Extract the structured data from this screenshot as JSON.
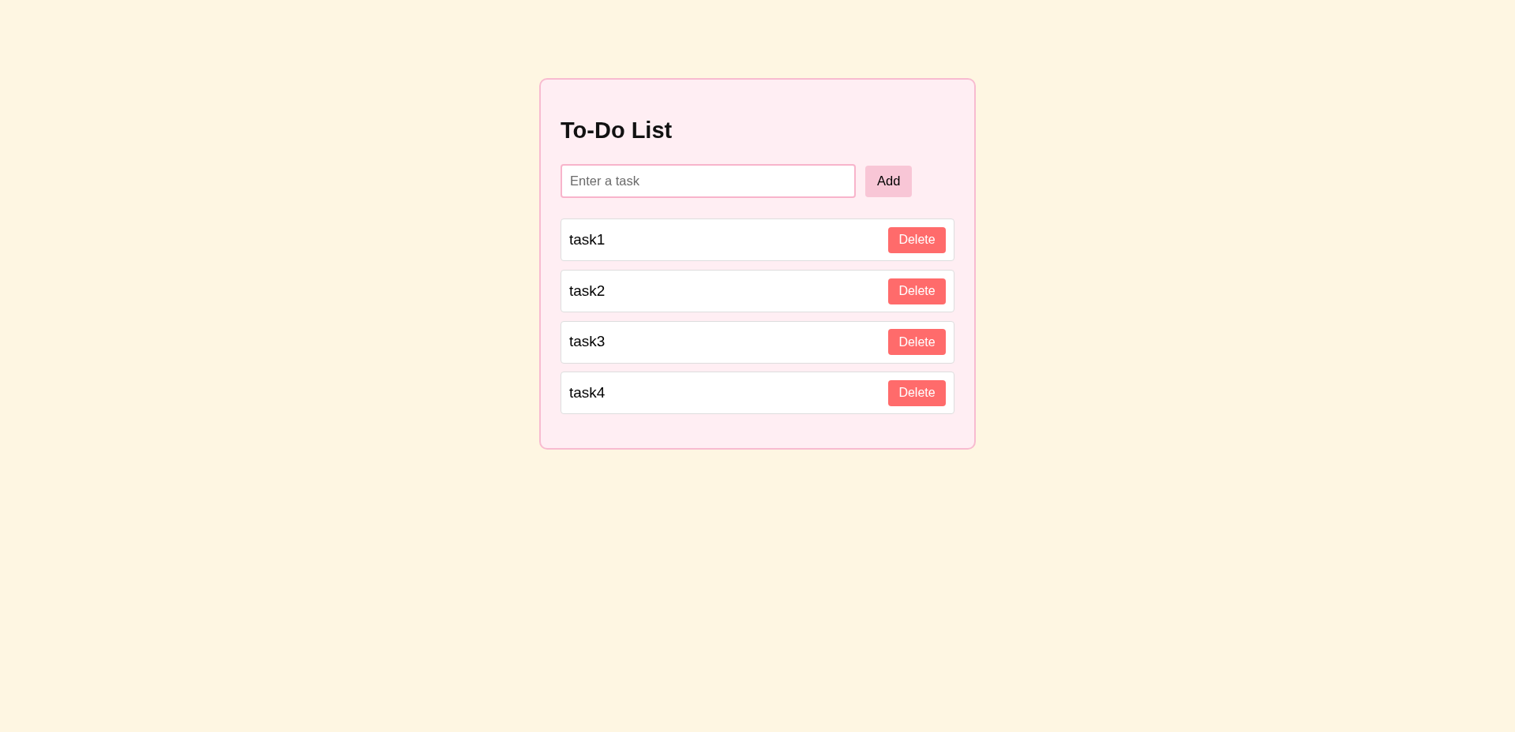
{
  "title": "To-Do List",
  "task_input": {
    "placeholder": "Enter a task"
  },
  "add_button": "Add",
  "tasks": [
    {
      "text": "task1",
      "delete_button": "Delete"
    },
    {
      "text": "task2",
      "delete_button": "Delete"
    },
    {
      "text": "task3",
      "delete_button": "Delete"
    },
    {
      "text": "task4",
      "delete_button": "Delete"
    }
  ]
}
